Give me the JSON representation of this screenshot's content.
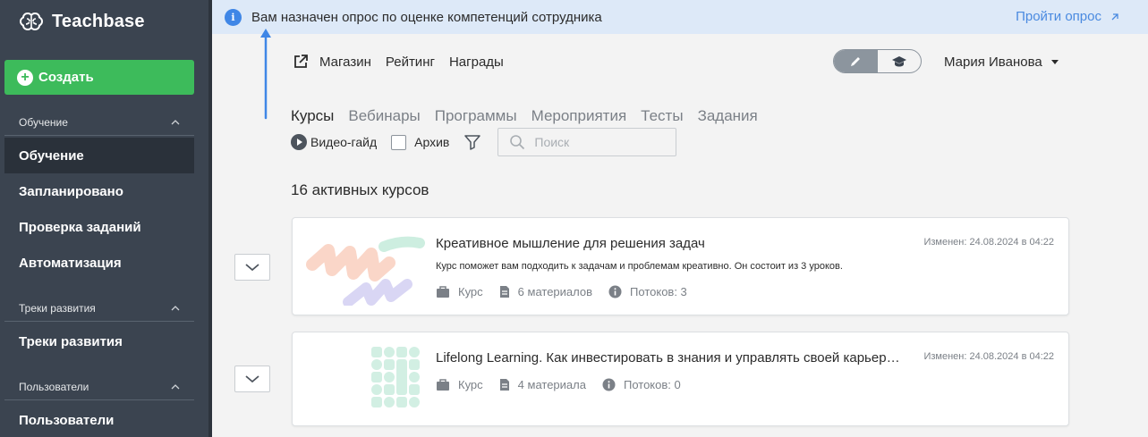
{
  "app": {
    "brand": "Teachbase"
  },
  "sidebar": {
    "create_label": "Создать",
    "sections": [
      {
        "title": "Обучение",
        "items": [
          "Обучение",
          "Запланировано",
          "Проверка заданий",
          "Автоматизация"
        ]
      },
      {
        "title": "Треки развития",
        "items": [
          "Треки развития"
        ]
      },
      {
        "title": "Пользователи",
        "items": [
          "Пользователи"
        ]
      }
    ],
    "active_item": "Обучение"
  },
  "banner": {
    "message": "Вам назначен опрос по оценке компетенций сотрудника",
    "action": "Пройти опрос",
    "info_glyph": "i"
  },
  "topnav": {
    "links": [
      "Магазин",
      "Рейтинг",
      "Награды"
    ],
    "user_name": "Мария Иванова"
  },
  "tabs": [
    "Курсы",
    "Вебинары",
    "Программы",
    "Мероприятия",
    "Тесты",
    "Задания"
  ],
  "active_tab": "Курсы",
  "filters": {
    "video_guide": "Видео-гайд",
    "archive": "Архив",
    "search_placeholder": "Поиск"
  },
  "courses_count": "16 активных курсов",
  "courses": [
    {
      "title": "Креативное мышление для решения задач",
      "modified": "Изменен: 24.08.2024 в 04:22",
      "description": "Курс поможет вам подходить к задачам и проблемам креативно. Он состоит из 3 уроков.",
      "type": "Курс",
      "materials": "6 материалов",
      "streams": "Потоков: 3"
    },
    {
      "title": "Lifelong Learning. Как инвестировать в знания и управлять своей карьерой",
      "modified": "Изменен: 24.08.2024 в 04:22",
      "description": "",
      "type": "Курс",
      "materials": "4 материала",
      "streams": "Потоков: 0"
    }
  ],
  "colors": {
    "sidebar": "#3b4450",
    "create": "#3dbb5b",
    "banner": "#dde9f8",
    "link": "#4a8ae0"
  }
}
